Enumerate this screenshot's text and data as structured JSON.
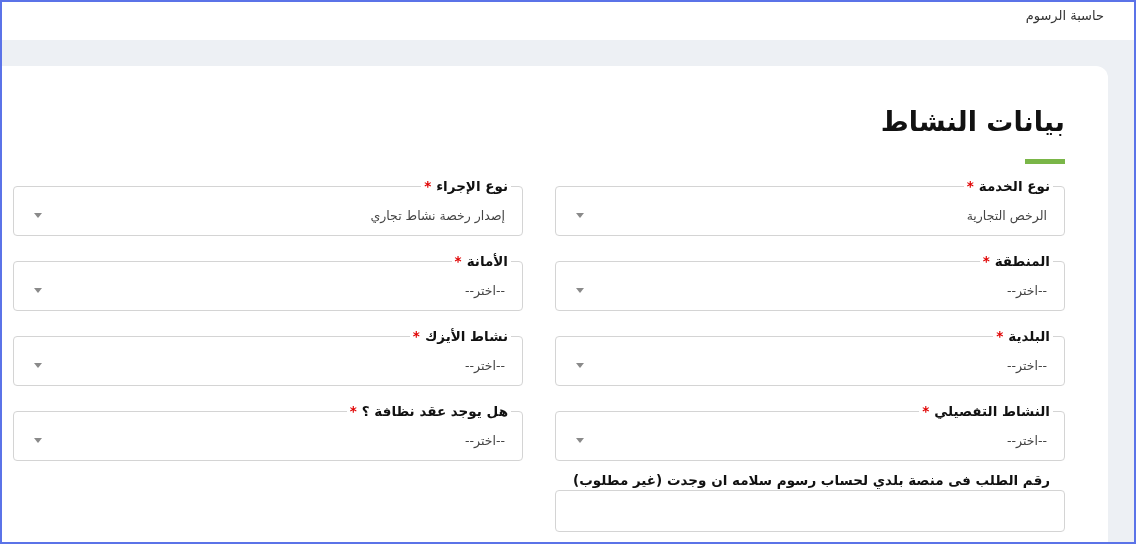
{
  "top_bar": {
    "title": "حاسبة الرسوم"
  },
  "section": {
    "title": "بيانات النشاط"
  },
  "fields": [
    {
      "kind": "select",
      "label": "نوع الخدمة",
      "required_mark": "*",
      "value": "الرخص التجارية"
    },
    {
      "kind": "select",
      "label": "نوع الإجراء",
      "required_mark": "*",
      "value": "إصدار رخصة نشاط تجاري"
    },
    {
      "kind": "select",
      "label": "المنطقة",
      "required_mark": "*",
      "value": "--اختر--"
    },
    {
      "kind": "select",
      "label": "الأمانة",
      "required_mark": "*",
      "value": "--اختر--"
    },
    {
      "kind": "select",
      "label": "البلدية",
      "required_mark": "*",
      "value": "--اختر--"
    },
    {
      "kind": "select",
      "label": "نشاط الأيزك",
      "required_mark": "*",
      "value": "--اختر--"
    },
    {
      "kind": "select",
      "label": "النشاط التفصيلي",
      "required_mark": "*",
      "value": "--اختر--"
    },
    {
      "kind": "select",
      "label": "هل يوجد عقد نظافة ؟",
      "required_mark": "*",
      "value": "--اختر--"
    },
    {
      "kind": "textarea",
      "label": "رقم الطلب فى منصة بلدي لحساب رسوم سلامه ان وجدت (غير مطلوب)"
    }
  ]
}
